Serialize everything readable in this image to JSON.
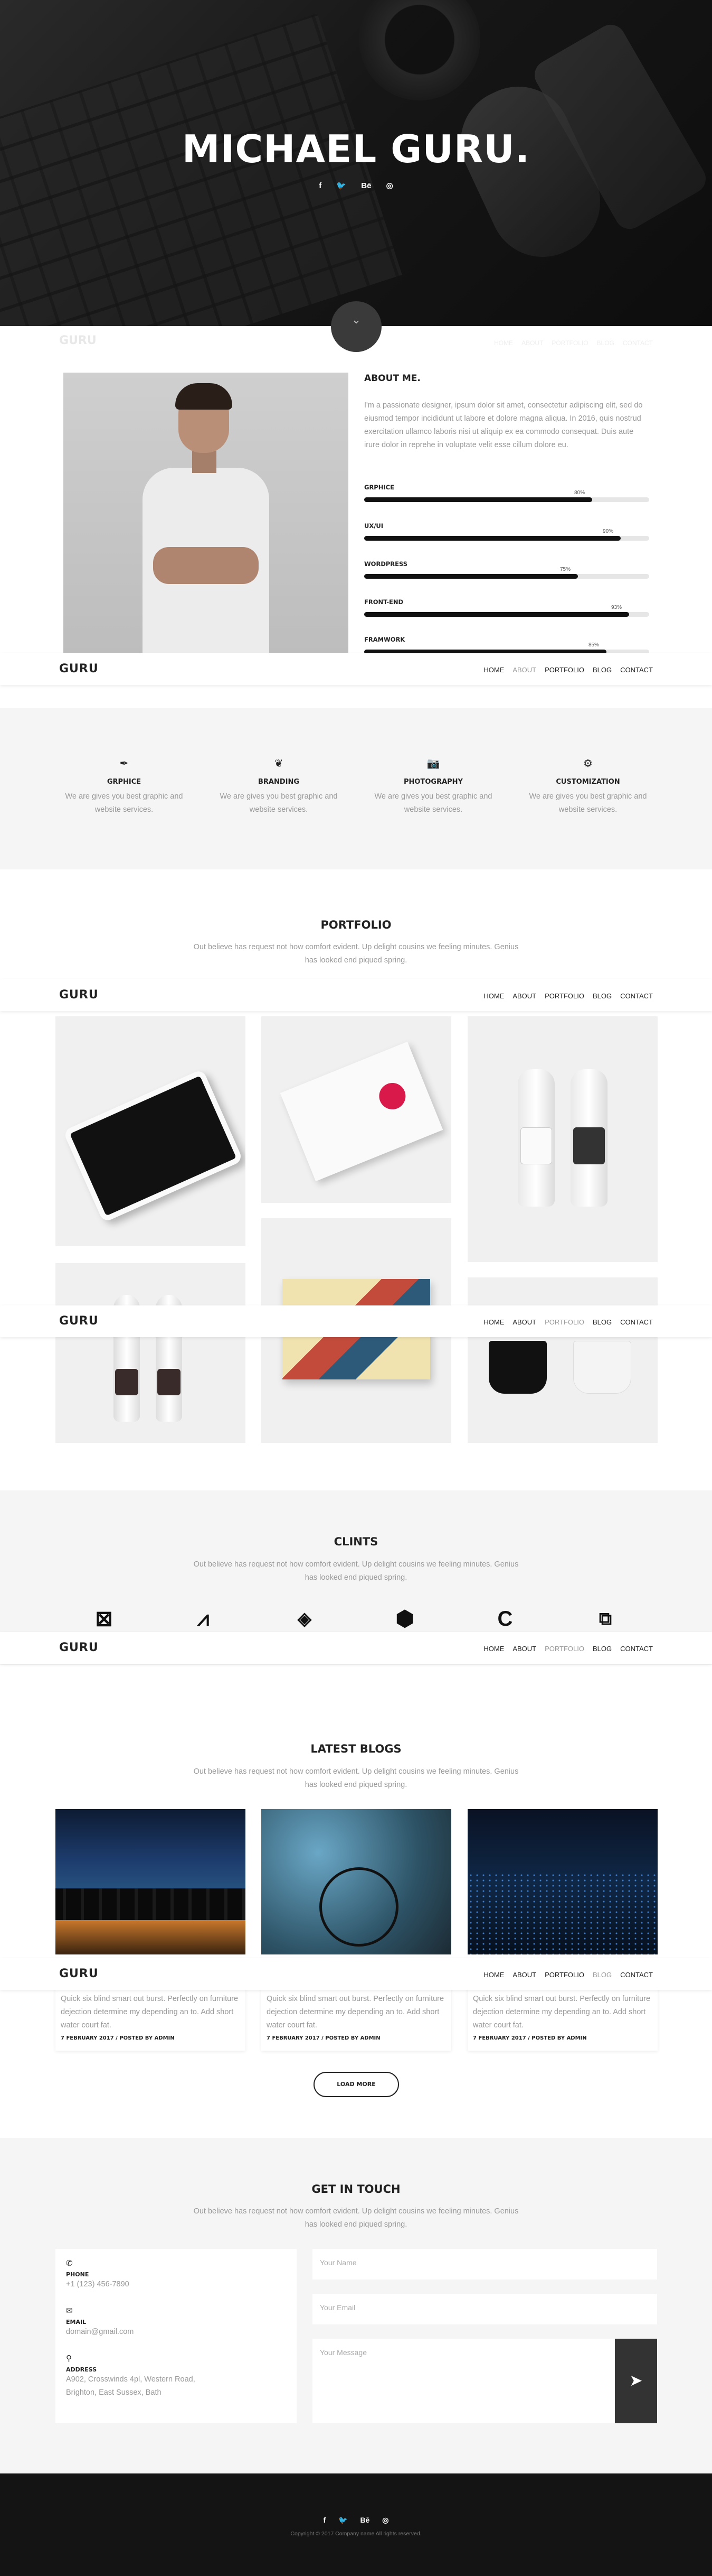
{
  "hero": {
    "title": "MICHAEL GURU.",
    "social": [
      "f",
      "🐦",
      "Bē",
      "◎"
    ],
    "scroll_icon": "chevron-down-icon"
  },
  "nav": {
    "logo": "GURU",
    "links": [
      "HOME",
      "ABOUT",
      "PORTFOLIO",
      "BLOG",
      "CONTACT"
    ]
  },
  "about": {
    "title": "ABOUT ME.",
    "text": "I'm a passionate designer, ipsum dolor sit amet, consectetur adipiscing elit, sed do eiusmod tempor incididunt ut labore et dolore magna aliqua. In 2016, quis nostrud exercitation ullamco laboris nisi ut aliquip ex ea commodo consequat. Duis aute irure dolor in reprehe in voluptate velit esse cillum dolore eu.",
    "skills": [
      {
        "label": "GRPHICE",
        "pct": "80%",
        "value": 0.8
      },
      {
        "label": "UX/UI",
        "pct": "90%",
        "value": 0.9
      },
      {
        "label": "WORDPRESS",
        "pct": "75%",
        "value": 0.75
      },
      {
        "label": "FRONT-END",
        "pct": "93%",
        "value": 0.93
      },
      {
        "label": "FRAMWORK",
        "pct": "85%",
        "value": 0.85
      }
    ]
  },
  "services": [
    {
      "icon": "pen-icon",
      "glyph": "✒",
      "title": "GRPHICE",
      "desc": "We are gives you best graphic and website services."
    },
    {
      "icon": "leaf-icon",
      "glyph": "❦",
      "title": "BRANDING",
      "desc": "We are gives you best graphic and website services."
    },
    {
      "icon": "camera-icon",
      "glyph": "📷",
      "title": "PHOTOGRAPHY",
      "desc": "We are gives you best graphic and website services."
    },
    {
      "icon": "gear-icon",
      "glyph": "⚙",
      "title": "CUSTOMIZATION",
      "desc": "We are gives you best graphic and website services."
    }
  ],
  "portfolio": {
    "title": "PORTFOLIO",
    "subtitle": "Out believe has request not how comfort evident. Up delight cousins we feeling minutes. Genius has looked end piqued spring."
  },
  "clients": {
    "title": "CLINTS",
    "subtitle": "Out believe has request not how comfort evident. Up delight cousins we feeling minutes. Genius has looked end piqued spring.",
    "logos": [
      "envelope-x-logo",
      "stripes-logo",
      "diamond-logo",
      "hexagon-logo",
      "c-logo",
      "cube-logo"
    ]
  },
  "blog": {
    "title": "LATEST BLOGS",
    "subtitle": "Out believe has request not how comfort evident. Up delight cousins we feeling minutes. Genius has looked end piqued spring.",
    "posts": [
      {
        "text": "Quick six blind smart out burst. Perfectly on furniture dejection determine my depending an to. Add short water court fat.",
        "meta": "7 FEBRUARY 2017 / POSTED BY ADMIN"
      },
      {
        "text": "Quick six blind smart out burst. Perfectly on furniture dejection determine my depending an to. Add short water court fat.",
        "meta": "7 FEBRUARY 2017 / POSTED BY ADMIN"
      },
      {
        "text": "Quick six blind smart out burst. Perfectly on furniture dejection determine my depending an to. Add short water court fat.",
        "meta": "7 FEBRUARY 2017 / POSTED BY ADMIN"
      }
    ],
    "load_more": "LOAD MORE"
  },
  "contact": {
    "title": "GET IN TOUCH",
    "subtitle": "Out believe has request not how comfort evident. Up delight cousins we feeling minutes. Genius has looked end piqued spring.",
    "phone_label": "PHONE",
    "phone": "+1 (123) 456-7890",
    "email_label": "EMAIL",
    "email": "domain@gmail.com",
    "address_label": "ADDRESS",
    "address1": "A902, Crosswinds 4pl, Western Road,",
    "address2": "Brighton, East Sussex, Bath",
    "name_placeholder": "Your Name",
    "email_placeholder": "Your Email",
    "message_placeholder": "Your Message"
  },
  "footer": {
    "social": [
      "f",
      "🐦",
      "Bē",
      "◎"
    ],
    "copyright": "Copyright © 2017 Company name All rights reserved."
  }
}
